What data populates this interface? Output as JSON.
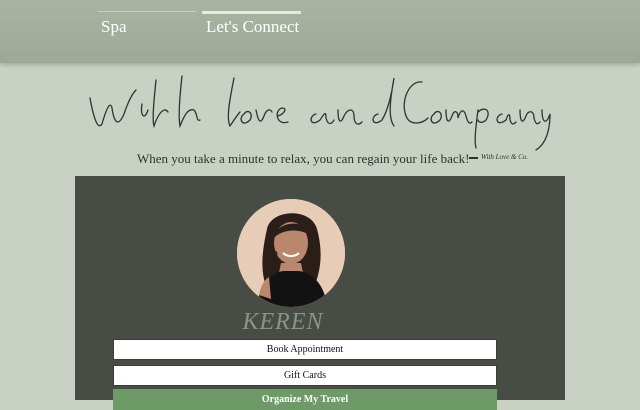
{
  "nav": {
    "items": [
      {
        "label": "Spa"
      },
      {
        "label": "Let's Connect"
      }
    ]
  },
  "hero": {
    "title": "With love and Company",
    "tagline": "When you take a minute to relax, you can regain your life back!",
    "signature": "With Love & Co."
  },
  "profile": {
    "name": "KEREN",
    "links": [
      {
        "label": "Book Appointment"
      },
      {
        "label": "Gift Cards"
      },
      {
        "label": "Organize My Travel"
      }
    ]
  },
  "colors": {
    "header": "#a3ae9c",
    "background": "#c9d1c5",
    "panel": "#474c45",
    "accent_button": "#6e9a68"
  }
}
